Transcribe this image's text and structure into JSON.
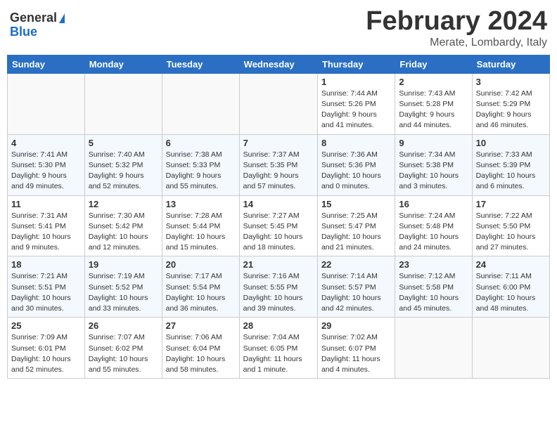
{
  "header": {
    "logo_general": "General",
    "logo_blue": "Blue",
    "title": "February 2024",
    "location": "Merate, Lombardy, Italy"
  },
  "days_of_week": [
    "Sunday",
    "Monday",
    "Tuesday",
    "Wednesday",
    "Thursday",
    "Friday",
    "Saturday"
  ],
  "weeks": [
    {
      "days": [
        {
          "num": "",
          "info": ""
        },
        {
          "num": "",
          "info": ""
        },
        {
          "num": "",
          "info": ""
        },
        {
          "num": "",
          "info": ""
        },
        {
          "num": "1",
          "info": "Sunrise: 7:44 AM\nSunset: 5:26 PM\nDaylight: 9 hours\nand 41 minutes."
        },
        {
          "num": "2",
          "info": "Sunrise: 7:43 AM\nSunset: 5:28 PM\nDaylight: 9 hours\nand 44 minutes."
        },
        {
          "num": "3",
          "info": "Sunrise: 7:42 AM\nSunset: 5:29 PM\nDaylight: 9 hours\nand 46 minutes."
        }
      ]
    },
    {
      "days": [
        {
          "num": "4",
          "info": "Sunrise: 7:41 AM\nSunset: 5:30 PM\nDaylight: 9 hours\nand 49 minutes."
        },
        {
          "num": "5",
          "info": "Sunrise: 7:40 AM\nSunset: 5:32 PM\nDaylight: 9 hours\nand 52 minutes."
        },
        {
          "num": "6",
          "info": "Sunrise: 7:38 AM\nSunset: 5:33 PM\nDaylight: 9 hours\nand 55 minutes."
        },
        {
          "num": "7",
          "info": "Sunrise: 7:37 AM\nSunset: 5:35 PM\nDaylight: 9 hours\nand 57 minutes."
        },
        {
          "num": "8",
          "info": "Sunrise: 7:36 AM\nSunset: 5:36 PM\nDaylight: 10 hours\nand 0 minutes."
        },
        {
          "num": "9",
          "info": "Sunrise: 7:34 AM\nSunset: 5:38 PM\nDaylight: 10 hours\nand 3 minutes."
        },
        {
          "num": "10",
          "info": "Sunrise: 7:33 AM\nSunset: 5:39 PM\nDaylight: 10 hours\nand 6 minutes."
        }
      ]
    },
    {
      "days": [
        {
          "num": "11",
          "info": "Sunrise: 7:31 AM\nSunset: 5:41 PM\nDaylight: 10 hours\nand 9 minutes."
        },
        {
          "num": "12",
          "info": "Sunrise: 7:30 AM\nSunset: 5:42 PM\nDaylight: 10 hours\nand 12 minutes."
        },
        {
          "num": "13",
          "info": "Sunrise: 7:28 AM\nSunset: 5:44 PM\nDaylight: 10 hours\nand 15 minutes."
        },
        {
          "num": "14",
          "info": "Sunrise: 7:27 AM\nSunset: 5:45 PM\nDaylight: 10 hours\nand 18 minutes."
        },
        {
          "num": "15",
          "info": "Sunrise: 7:25 AM\nSunset: 5:47 PM\nDaylight: 10 hours\nand 21 minutes."
        },
        {
          "num": "16",
          "info": "Sunrise: 7:24 AM\nSunset: 5:48 PM\nDaylight: 10 hours\nand 24 minutes."
        },
        {
          "num": "17",
          "info": "Sunrise: 7:22 AM\nSunset: 5:50 PM\nDaylight: 10 hours\nand 27 minutes."
        }
      ]
    },
    {
      "days": [
        {
          "num": "18",
          "info": "Sunrise: 7:21 AM\nSunset: 5:51 PM\nDaylight: 10 hours\nand 30 minutes."
        },
        {
          "num": "19",
          "info": "Sunrise: 7:19 AM\nSunset: 5:52 PM\nDaylight: 10 hours\nand 33 minutes."
        },
        {
          "num": "20",
          "info": "Sunrise: 7:17 AM\nSunset: 5:54 PM\nDaylight: 10 hours\nand 36 minutes."
        },
        {
          "num": "21",
          "info": "Sunrise: 7:16 AM\nSunset: 5:55 PM\nDaylight: 10 hours\nand 39 minutes."
        },
        {
          "num": "22",
          "info": "Sunrise: 7:14 AM\nSunset: 5:57 PM\nDaylight: 10 hours\nand 42 minutes."
        },
        {
          "num": "23",
          "info": "Sunrise: 7:12 AM\nSunset: 5:58 PM\nDaylight: 10 hours\nand 45 minutes."
        },
        {
          "num": "24",
          "info": "Sunrise: 7:11 AM\nSunset: 6:00 PM\nDaylight: 10 hours\nand 48 minutes."
        }
      ]
    },
    {
      "days": [
        {
          "num": "25",
          "info": "Sunrise: 7:09 AM\nSunset: 6:01 PM\nDaylight: 10 hours\nand 52 minutes."
        },
        {
          "num": "26",
          "info": "Sunrise: 7:07 AM\nSunset: 6:02 PM\nDaylight: 10 hours\nand 55 minutes."
        },
        {
          "num": "27",
          "info": "Sunrise: 7:06 AM\nSunset: 6:04 PM\nDaylight: 10 hours\nand 58 minutes."
        },
        {
          "num": "28",
          "info": "Sunrise: 7:04 AM\nSunset: 6:05 PM\nDaylight: 11 hours\nand 1 minute."
        },
        {
          "num": "29",
          "info": "Sunrise: 7:02 AM\nSunset: 6:07 PM\nDaylight: 11 hours\nand 4 minutes."
        },
        {
          "num": "",
          "info": ""
        },
        {
          "num": "",
          "info": ""
        }
      ]
    }
  ]
}
